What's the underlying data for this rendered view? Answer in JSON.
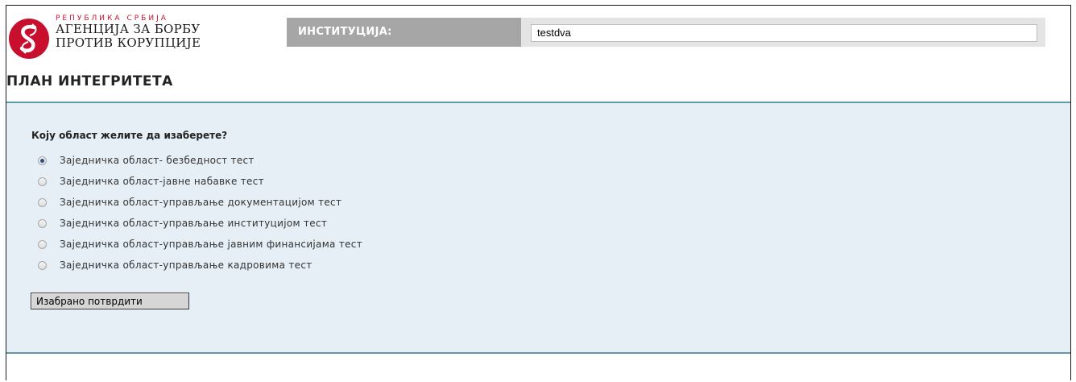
{
  "header": {
    "logo_small": "РЕПУБЛИКА СРБИЈА",
    "logo_line1": "АГЕНЦИЈА ЗА БОРБУ",
    "logo_line2": "ПРОТИВ КОРУПЦИЈЕ",
    "logo_icon": "agency-emblem-icon",
    "institution_label": "ИНСТИТУЦИЈА:",
    "institution_value": "testdva"
  },
  "page_title": "ПЛАН ИНТЕГРИТЕТА",
  "form": {
    "question": "Коју област желите да изаберете?",
    "options": [
      {
        "label": "Заједничка област- безбедност тест",
        "checked": true
      },
      {
        "label": "Заједничка област-јавне набавке тест",
        "checked": false
      },
      {
        "label": "Заједничка област-управљање документацијом тест",
        "checked": false
      },
      {
        "label": "Заједничка област-управљање институцијом тест",
        "checked": false
      },
      {
        "label": "Заједничка област-управљање јавним финансијама тест",
        "checked": false
      },
      {
        "label": "Заједничка област-управљање кадровима тест",
        "checked": false
      }
    ],
    "submit_label": "Изабрано потврдити"
  },
  "colors": {
    "brand_red": "#c8102e",
    "panel_bg": "#e6eff5",
    "panel_border": "#5f9ca6",
    "label_bg": "#a6a6a6"
  }
}
